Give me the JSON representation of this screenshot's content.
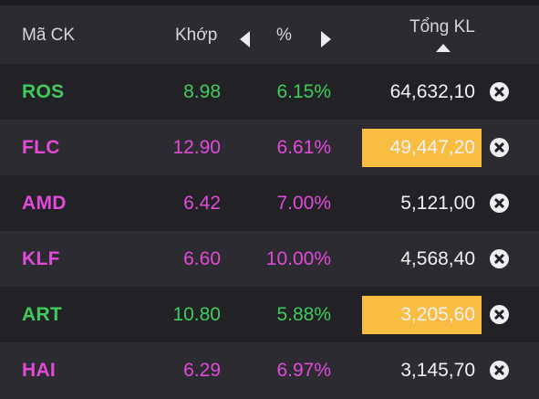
{
  "colors": {
    "up": "#3ecb5c",
    "ceiling": "#e24ad8",
    "highlight": "#f9bd41",
    "volume_text": "#f1f1f3"
  },
  "header": {
    "code_label": "Mã CK",
    "price_label": "Khớp",
    "pct_label": "%",
    "volume_label": "Tổng KL",
    "left_icon": "caret-left-icon",
    "right_icon": "caret-right-icon",
    "sort_icon": "sort-ascending-icon"
  },
  "rows": [
    {
      "code": "ROS",
      "price": "8.98",
      "pct": "6.15%",
      "volume": "64,632,10",
      "color": "#3ecb5c",
      "highlight": false
    },
    {
      "code": "FLC",
      "price": "12.90",
      "pct": "6.61%",
      "volume": "49,447,20",
      "color": "#e24ad8",
      "highlight": true
    },
    {
      "code": "AMD",
      "price": "6.42",
      "pct": "7.00%",
      "volume": "5,121,00",
      "color": "#e24ad8",
      "highlight": false
    },
    {
      "code": "KLF",
      "price": "6.60",
      "pct": "10.00%",
      "volume": "4,568,40",
      "color": "#e24ad8",
      "highlight": false
    },
    {
      "code": "ART",
      "price": "10.80",
      "pct": "5.88%",
      "volume": "3,205,60",
      "color": "#3ecb5c",
      "highlight": true
    },
    {
      "code": "HAI",
      "price": "6.29",
      "pct": "6.97%",
      "volume": "3,145,70",
      "color": "#e24ad8",
      "highlight": false
    }
  ]
}
